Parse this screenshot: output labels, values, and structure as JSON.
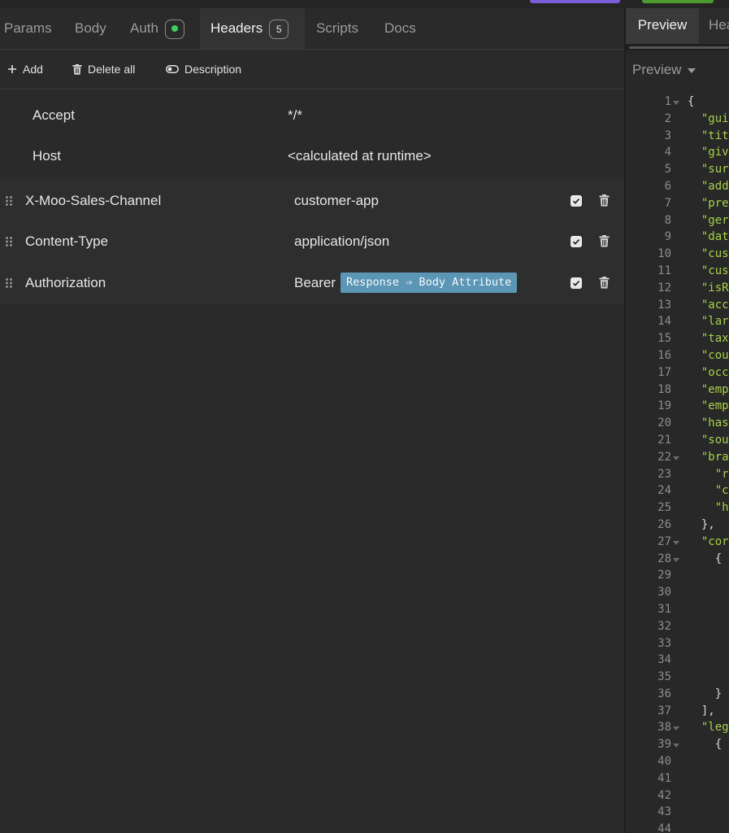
{
  "tabs": [
    {
      "label": "Params"
    },
    {
      "label": "Body"
    },
    {
      "label": "Auth",
      "status": "enabled"
    },
    {
      "label": "Headers",
      "count": "5",
      "active": true
    },
    {
      "label": "Scripts"
    },
    {
      "label": "Docs"
    }
  ],
  "toolbar": {
    "add_label": "Add",
    "delete_all_label": "Delete all",
    "description_label": "Description"
  },
  "readonly_headers": [
    {
      "key": "Accept",
      "value": "*/*"
    },
    {
      "key": "Host",
      "value": "<calculated at runtime>"
    }
  ],
  "headers": [
    {
      "key": "X-Moo-Sales-Channel",
      "value": "customer-app",
      "enabled": true
    },
    {
      "key": "Content-Type",
      "value": "application/json",
      "enabled": true
    },
    {
      "key": "Authorization",
      "value": "Bearer",
      "tag": "Response ⇒ Body Attribute",
      "enabled": true
    }
  ],
  "right_panel": {
    "tabs": [
      {
        "label": "Preview",
        "active": true
      },
      {
        "label": "Hea"
      }
    ],
    "preview_dropdown": "Preview",
    "code_lines": [
      {
        "n": "1",
        "fold": true,
        "text": "{"
      },
      {
        "n": "2",
        "text": "  \"gui"
      },
      {
        "n": "3",
        "text": "  \"tit"
      },
      {
        "n": "4",
        "text": "  \"giv"
      },
      {
        "n": "5",
        "text": "  \"sur"
      },
      {
        "n": "6",
        "text": "  \"add"
      },
      {
        "n": "7",
        "text": "  \"pre"
      },
      {
        "n": "8",
        "text": "  \"ger"
      },
      {
        "n": "9",
        "text": "  \"dat"
      },
      {
        "n": "10",
        "text": "  \"cus"
      },
      {
        "n": "11",
        "text": "  \"cus"
      },
      {
        "n": "12",
        "text": "  \"isR"
      },
      {
        "n": "13",
        "text": "  \"acc"
      },
      {
        "n": "14",
        "text": "  \"lar"
      },
      {
        "n": "15",
        "text": "  \"tax"
      },
      {
        "n": "16",
        "text": "  \"cou"
      },
      {
        "n": "17",
        "text": "  \"occ"
      },
      {
        "n": "18",
        "text": "  \"emp"
      },
      {
        "n": "19",
        "text": "  \"emp"
      },
      {
        "n": "20",
        "text": "  \"has"
      },
      {
        "n": "21",
        "text": "  \"sou"
      },
      {
        "n": "22",
        "fold": true,
        "text": "  \"bra"
      },
      {
        "n": "23",
        "text": "    \"r"
      },
      {
        "n": "24",
        "text": "    \"c"
      },
      {
        "n": "25",
        "text": "    \"h"
      },
      {
        "n": "26",
        "text": "  },"
      },
      {
        "n": "27",
        "fold": true,
        "text": "  \"cor"
      },
      {
        "n": "28",
        "fold": true,
        "text": "    {"
      },
      {
        "n": "29",
        "text": ""
      },
      {
        "n": "30",
        "text": ""
      },
      {
        "n": "31",
        "text": ""
      },
      {
        "n": "32",
        "text": ""
      },
      {
        "n": "33",
        "text": ""
      },
      {
        "n": "34",
        "text": ""
      },
      {
        "n": "35",
        "text": ""
      },
      {
        "n": "36",
        "text": "    }"
      },
      {
        "n": "37",
        "text": "  ],"
      },
      {
        "n": "38",
        "fold": true,
        "text": "  \"leg"
      },
      {
        "n": "39",
        "fold": true,
        "text": "    {"
      },
      {
        "n": "40",
        "text": ""
      },
      {
        "n": "41",
        "text": ""
      },
      {
        "n": "42",
        "text": ""
      },
      {
        "n": "43",
        "text": ""
      },
      {
        "n": "44",
        "text": ""
      }
    ]
  }
}
